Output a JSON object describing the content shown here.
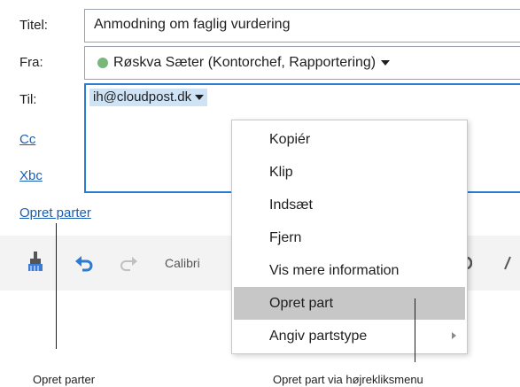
{
  "form": {
    "title_label": "Titel:",
    "title_value": "Anmodning om faglig vurdering",
    "from_label": "Fra:",
    "from_value": "Røskva Sæter (Kontorchef, Rapportering)",
    "to_label": "Til:",
    "to_recipient": "ih@cloudpost.dk",
    "cc_link": "Cc",
    "xbc_link": "Xbc",
    "create_parties_link": "Opret parter"
  },
  "toolbar": {
    "font_name": "Calibri",
    "icons": [
      "paint-brush-icon",
      "undo-icon",
      "redo-icon",
      "bold-partial-icon",
      "italic-partial-icon"
    ]
  },
  "context_menu": {
    "items": [
      {
        "label": "Kopiér",
        "highlighted": false,
        "submenu": false
      },
      {
        "label": "Klip",
        "highlighted": false,
        "submenu": false
      },
      {
        "label": "Indsæt",
        "highlighted": false,
        "submenu": false
      },
      {
        "label": "Fjern",
        "highlighted": false,
        "submenu": false
      },
      {
        "label": "Vis mere information",
        "highlighted": false,
        "submenu": false
      },
      {
        "label": "Opret part",
        "highlighted": true,
        "submenu": false
      },
      {
        "label": "Angiv partstype",
        "highlighted": false,
        "submenu": true
      }
    ]
  },
  "callouts": {
    "left": "Opret parter",
    "right": "Opret part via højrekliksmenu"
  },
  "colors": {
    "link": "#1a5fb4",
    "focus_border": "#2b7cd3",
    "chip_bg": "#cfe3f7",
    "menu_highlight": "#c7c7c7",
    "presence": "#7ab87a",
    "undo_icon": "#2b7cd3"
  }
}
